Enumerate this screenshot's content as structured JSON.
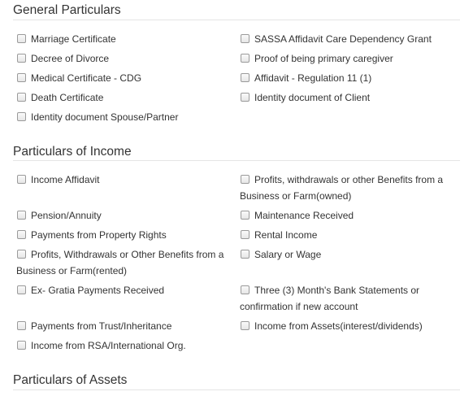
{
  "sections": [
    {
      "title": "General Particulars",
      "items": [
        {
          "label": "Marriage Certificate"
        },
        {
          "label": "SASSA Affidavit Care Dependency Grant"
        },
        {
          "label": "Decree of Divorce"
        },
        {
          "label": "Proof of being primary caregiver"
        },
        {
          "label": "Medical Certificate - CDG"
        },
        {
          "label": "Affidavit - Regulation 11 (1)"
        },
        {
          "label": "Death Certificate"
        },
        {
          "label": "Identity document of Client"
        },
        {
          "label": "Identity document Spouse/Partner"
        }
      ]
    },
    {
      "title": "Particulars of Income",
      "items": [
        {
          "label": "Income Affidavit"
        },
        {
          "label": "Profits, withdrawals or other Benefits from a",
          "label2": "Business or Farm(owned)"
        },
        {
          "label": "Pension/Annuity"
        },
        {
          "label": "Maintenance Received"
        },
        {
          "label": "Payments from Property Rights"
        },
        {
          "label": "Rental Income"
        },
        {
          "label": "Profits, Withdrawals or Other Benefits from a",
          "label2": "Business or Farm(rented)"
        },
        {
          "label": "Salary or Wage"
        },
        {
          "label": "Ex- Gratia Payments Received"
        },
        {
          "label": "Three (3) Month's Bank Statements or",
          "label2": "confirmation if new account"
        },
        {
          "label": "Payments from Trust/Inheritance"
        },
        {
          "label": "Income from Assets(interest/dividends)"
        },
        {
          "label": "Income from RSA/International Org."
        }
      ]
    },
    {
      "title": "Particulars of Assets",
      "items": []
    }
  ]
}
